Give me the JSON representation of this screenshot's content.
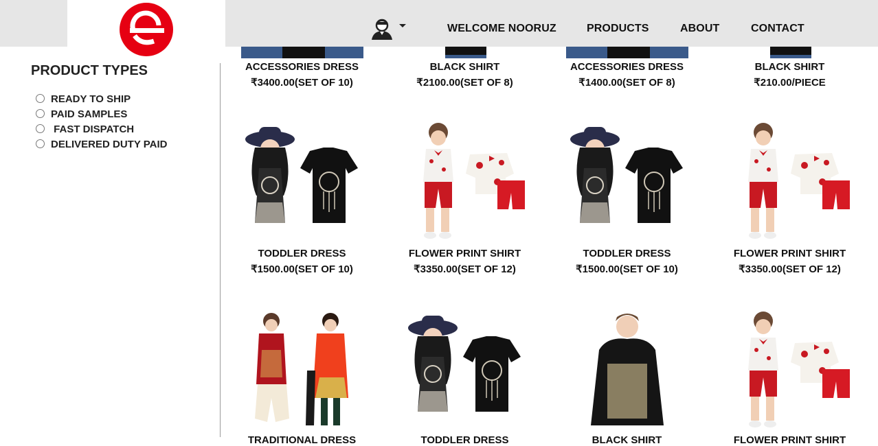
{
  "header": {
    "nav": [
      "WELCOME NOORUZ",
      "PRODUCTS",
      "ABOUT",
      "CONTACT"
    ]
  },
  "colors": {
    "brand": "#e60012",
    "header_bg": "#e6e6e6"
  },
  "sidebar": {
    "title": "PRODUCT TYPES",
    "filters": [
      "READY TO SHIP",
      "PAID SAMPLES",
      " FAST DISPATCH",
      "DELIVERED DUTY PAID"
    ]
  },
  "products": [
    {
      "name": "ACCESSORIES DRESS",
      "price": "₹3400.00(SET OF 10)",
      "image": "accessories-dress"
    },
    {
      "name": "BLACK SHIRT",
      "price": "₹2100.00(SET OF 8)",
      "image": "black-shirt"
    },
    {
      "name": "ACCESSORIES DRESS",
      "price": "₹1400.00(SET OF 8)",
      "image": "accessories-dress"
    },
    {
      "name": "BLACK SHIRT",
      "price": "₹210.00/PIECE",
      "image": "black-shirt"
    },
    {
      "name": "TODDLER DRESS",
      "price": "₹1500.00(SET OF 10)",
      "image": "toddler-dress"
    },
    {
      "name": "FLOWER PRINT SHIRT",
      "price": "₹3350.00(SET OF 12)",
      "image": "flower-print-shirt"
    },
    {
      "name": "TODDLER DRESS",
      "price": "₹1500.00(SET OF 10)",
      "image": "toddler-dress"
    },
    {
      "name": "FLOWER PRINT SHIRT",
      "price": "₹3350.00(SET OF 12)",
      "image": "flower-print-shirt"
    },
    {
      "name": "TRADITIONAL DRESS",
      "price": "",
      "image": "traditional-dress"
    },
    {
      "name": "TODDLER DRESS",
      "price": "",
      "image": "toddler-dress"
    },
    {
      "name": "BLACK SHIRT",
      "price": "",
      "image": "just-be-nice-hoodie"
    },
    {
      "name": "FLOWER PRINT SHIRT",
      "price": "",
      "image": "flower-print-shirt"
    }
  ]
}
